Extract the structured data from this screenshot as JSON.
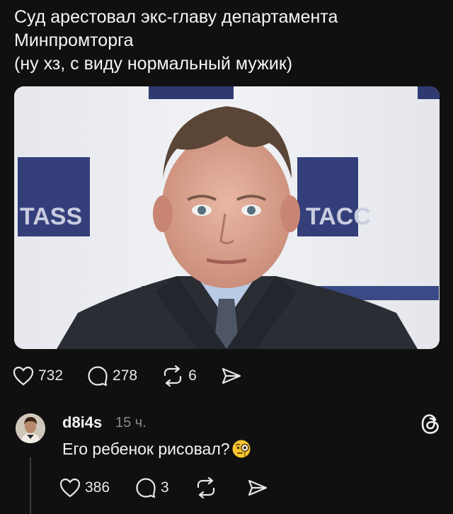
{
  "post": {
    "lines": [
      "Суд арестовал экс-главу департамента",
      "Минпромторга",
      "(ну хз, с виду нормальный мужик)"
    ],
    "image": {
      "backdrop_text": [
        "TASS",
        "TACC"
      ]
    },
    "likes": "732",
    "comments": "278",
    "reposts": "6"
  },
  "reply": {
    "username": "d8i4s",
    "time": "15 ч.",
    "text": "Его ребенок рисовал?",
    "emoji_icon": "face-with-monocle-icon",
    "likes": "386",
    "comments": "3"
  },
  "icons": {
    "like": "heart-icon",
    "comment": "comment-bubble-icon",
    "repost": "repost-icon",
    "share": "send-icon",
    "app": "threads-logo-icon"
  }
}
